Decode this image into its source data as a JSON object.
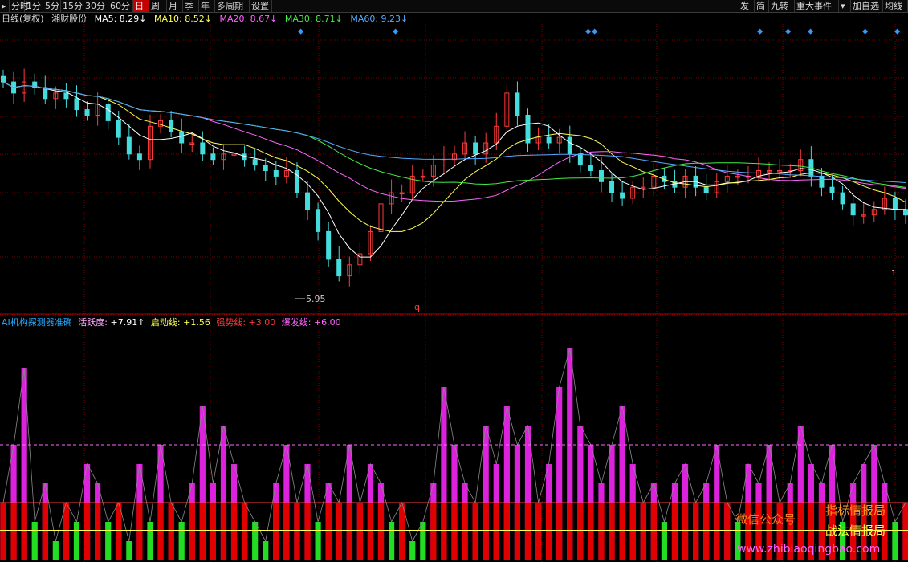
{
  "toolbar": {
    "left_items": [
      "分时",
      "1分",
      "5分",
      "15分",
      "30分",
      "60分",
      "日",
      "周",
      "月",
      "季",
      "年",
      "多周期",
      "设置"
    ],
    "active_item": "日",
    "right_items": [
      "发",
      "简",
      "九转",
      "重大事件",
      "加自选",
      "均线"
    ]
  },
  "main_legend": {
    "period": "日线(复权)",
    "stock_name": "湘财股份",
    "ma5": {
      "label": "MA5: 8.29↓",
      "color": "#ffffff"
    },
    "ma10": {
      "label": "MA10: 8.52↓",
      "color": "#ffff55"
    },
    "ma20": {
      "label": "MA20: 8.67↓",
      "color": "#ff66ff"
    },
    "ma30": {
      "label": "MA30: 8.71↓",
      "color": "#44ee44"
    },
    "ma60": {
      "label": "MA60: 9.23↓",
      "color": "#55aaff"
    }
  },
  "annotations": {
    "low_price": "5.95",
    "marker_q": "q",
    "end_price": "1"
  },
  "sub_legend": {
    "title": "AI机构探测器准确",
    "active_label": "活跃度: ",
    "active_value": "+7.91↑",
    "start_label": "启动线: ",
    "start_value": "+1.56",
    "strong_label": "强势线: ",
    "strong_value": "+3.00",
    "burst_label": "爆发线: ",
    "burst_value": "+6.00"
  },
  "watermarks": {
    "line1_left": "微信公众号",
    "line1_right": "指标情报局",
    "line2_right": "战法情报局",
    "site": "www.zhibiaoqingbao.com"
  },
  "colors": {
    "up": "#ff3b3b",
    "down": "#44dddd",
    "ma5": "#ffffff",
    "ma10": "#ffff55",
    "ma20": "#ff66ff",
    "ma30": "#44ee44",
    "ma60": "#55aaff",
    "grid": "#7a0000",
    "bar_magenta": "#dd22dd",
    "bar_red": "#e00000",
    "bar_green": "#22dd22",
    "diamond": "#3399ff"
  },
  "chart_data": {
    "type": "candlestick",
    "stock": "湘财股份",
    "period": "日线(复权)",
    "price_min": 5.95,
    "last_ma": {
      "ma5": 8.29,
      "ma10": 8.52,
      "ma20": 8.67,
      "ma30": 8.71,
      "ma60": 9.23
    },
    "ohlc_close_trend": [
      9.6,
      9.4,
      9.6,
      9.5,
      9.3,
      9.4,
      9.3,
      9.1,
      9.0,
      9.2,
      8.9,
      8.6,
      8.3,
      8.2,
      8.8,
      8.9,
      8.7,
      8.5,
      8.5,
      8.3,
      8.2,
      8.3,
      8.3,
      8.2,
      8.1,
      8.0,
      7.9,
      8.0,
      7.6,
      7.3,
      6.9,
      6.4,
      6.1,
      6.3,
      6.5,
      6.9,
      7.4,
      7.6,
      7.6,
      7.9,
      7.9,
      8.1,
      8.2,
      8.3,
      8.5,
      8.3,
      8.5,
      8.8,
      9.4,
      9.0,
      8.5,
      8.6,
      8.5,
      8.6,
      8.3,
      8.1,
      8.0,
      7.8,
      7.6,
      7.5,
      7.7,
      7.7,
      7.9,
      7.8,
      7.7,
      7.9,
      7.7,
      7.6,
      7.8,
      7.9,
      7.9,
      7.9,
      8.0,
      8.0,
      8.0,
      8.0,
      8.2,
      7.9,
      7.7,
      7.6,
      7.4,
      7.2,
      7.2,
      7.3,
      7.5,
      7.3,
      7.2
    ],
    "indicator": {
      "name": "AI机构探测器准确",
      "active_value": 7.91,
      "thresholds": {
        "start": 1.56,
        "strong": 3.0,
        "burst": 6.0
      },
      "values": [
        3,
        6,
        10,
        2,
        4,
        1,
        3,
        2,
        5,
        4,
        2,
        3,
        1,
        5,
        2,
        6,
        3,
        2,
        4,
        8,
        4,
        7,
        5,
        3,
        2,
        1,
        4,
        6,
        3,
        5,
        2,
        4,
        3,
        6,
        3,
        5,
        4,
        2,
        3,
        1,
        2,
        4,
        9,
        6,
        4,
        3,
        7,
        5,
        8,
        6,
        7,
        3,
        5,
        9,
        11,
        7,
        6,
        4,
        6,
        8,
        5,
        3,
        4,
        2,
        4,
        5,
        3,
        4,
        6,
        3,
        2,
        5,
        4,
        6,
        3,
        4,
        7,
        5,
        4,
        6,
        2,
        4,
        5,
        6,
        4,
        2,
        3
      ]
    }
  }
}
